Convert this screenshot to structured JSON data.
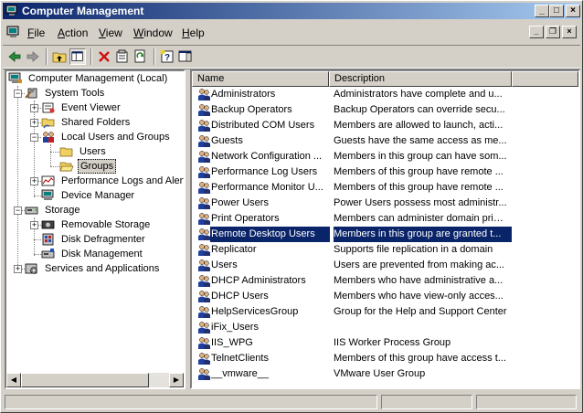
{
  "window": {
    "title": "Computer Management",
    "buttons": {
      "minimize": "_",
      "maximize": "□",
      "close": "×"
    }
  },
  "menu": [
    {
      "key": "F",
      "rest": "ile"
    },
    {
      "key": "A",
      "rest": "ction"
    },
    {
      "key": "V",
      "rest": "iew"
    },
    {
      "key": "W",
      "rest": "indow"
    },
    {
      "key": "H",
      "rest": "elp"
    }
  ],
  "mdi_buttons": {
    "minimize": "_",
    "restore": "❐",
    "close": "×"
  },
  "toolbar": [
    "back-icon",
    "forward-icon",
    "up-level-icon",
    "show-hide-tree-icon",
    "delete-icon",
    "properties-icon",
    "refresh-icon",
    "export-list-icon",
    "help-icon",
    "show-hide-action-pane-icon"
  ],
  "tree": {
    "root": "Computer Management (Local)",
    "system_tools": "System Tools",
    "event_viewer": "Event Viewer",
    "shared_folders": "Shared Folders",
    "local_users_groups": "Local Users and Groups",
    "users": "Users",
    "groups": "Groups",
    "perf_logs": "Performance Logs and Alerts",
    "device_manager": "Device Manager",
    "storage": "Storage",
    "removable_storage": "Removable Storage",
    "disk_defrag": "Disk Defragmenter",
    "disk_management": "Disk Management",
    "services_apps": "Services and Applications"
  },
  "list": {
    "columns": [
      "Name",
      "Description"
    ],
    "selected_index": 9,
    "rows": [
      {
        "name": "Administrators",
        "desc": "Administrators have complete and u..."
      },
      {
        "name": "Backup Operators",
        "desc": "Backup Operators can override secu..."
      },
      {
        "name": "Distributed COM Users",
        "desc": "Members are allowed to launch, acti..."
      },
      {
        "name": "Guests",
        "desc": "Guests have the same access as me..."
      },
      {
        "name": "Network Configuration ...",
        "desc": "Members in this group can have som..."
      },
      {
        "name": "Performance Log Users",
        "desc": "Members of this group have remote ..."
      },
      {
        "name": "Performance Monitor U...",
        "desc": "Members of this group have remote ..."
      },
      {
        "name": "Power Users",
        "desc": "Power Users possess most administr..."
      },
      {
        "name": "Print Operators",
        "desc": "Members can administer domain prin..."
      },
      {
        "name": "Remote Desktop Users",
        "desc": "Members in this group are granted t..."
      },
      {
        "name": "Replicator",
        "desc": "Supports file replication in a domain"
      },
      {
        "name": "Users",
        "desc": "Users are prevented from making ac..."
      },
      {
        "name": "DHCP Administrators",
        "desc": "Members who have administrative a..."
      },
      {
        "name": "DHCP Users",
        "desc": "Members who have view-only acces..."
      },
      {
        "name": "HelpServicesGroup",
        "desc": "Group for the Help and Support Center"
      },
      {
        "name": "iFix_Users",
        "desc": ""
      },
      {
        "name": "IIS_WPG",
        "desc": "IIS Worker Process Group"
      },
      {
        "name": "TelnetClients",
        "desc": "Members of this group have access t..."
      },
      {
        "name": "__vmware__",
        "desc": "VMware User Group"
      }
    ]
  }
}
